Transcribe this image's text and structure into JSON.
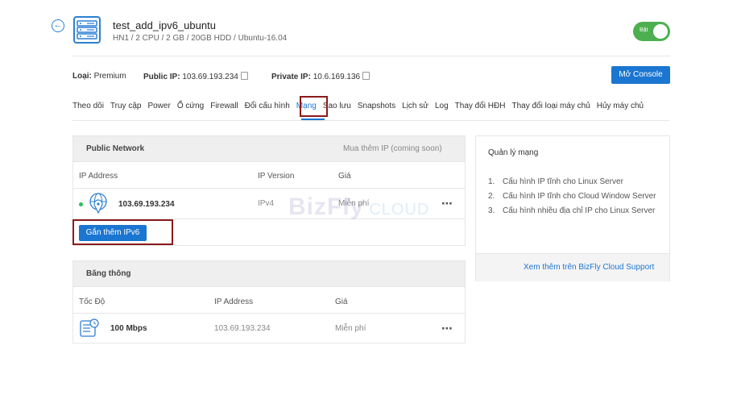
{
  "header": {
    "title": "test_add_ipv6_ubuntu",
    "subtitle": "HN1 / 2 CPU / 2 GB / 20GB HDD / Ubuntu-16.04",
    "toggle_label": "Bật"
  },
  "info": {
    "type_label": "Loại:",
    "type_value": "Premium",
    "public_ip_label": "Public IP:",
    "public_ip_value": "103.69.193.234",
    "private_ip_label": "Private IP:",
    "private_ip_value": "10.6.169.136",
    "console_button": "Mở Console"
  },
  "tabs": [
    "Theo dõi",
    "Truy cập",
    "Power",
    "Ổ cứng",
    "Firewall",
    "Đổi cấu hình",
    "Mạng",
    "Sao lưu",
    "Snapshots",
    "Lịch sử",
    "Log",
    "Thay đổi HĐH",
    "Thay đổi loại máy chủ",
    "Hủy máy chủ"
  ],
  "active_tab": "Mạng",
  "public_network": {
    "title": "Public Network",
    "buy_ip": "Mua thêm IP (coming soon)",
    "columns": [
      "IP Address",
      "IP Version",
      "Giá"
    ],
    "row": {
      "ip": "103.69.193.234",
      "version": "IPv4",
      "price": "Miễn phí",
      "status": "active"
    },
    "attach_ipv6_button": "Gắn thêm IPv6"
  },
  "bandwidth": {
    "title": "Băng thông",
    "columns": [
      "Tốc Độ",
      "IP Address",
      "Giá"
    ],
    "row": {
      "speed": "100 Mbps",
      "ip": "103.69.193.234",
      "price": "Miễn phí"
    }
  },
  "side_panel": {
    "title": "Quản lý mạng",
    "items": [
      "Cấu hình IP tĩnh cho Linux Server",
      "Cấu hình IP tĩnh cho Cloud Window Server",
      "Cấu hình nhiều địa chỉ IP cho Linux Server"
    ],
    "support_link": "Xem thêm trên BizFly Cloud Support"
  },
  "watermark": {
    "brand": "BizFly",
    "suffix": "CLOUD"
  },
  "colors": {
    "accent": "#1b76d1",
    "toggle_on": "#4caf50",
    "status_active": "#2cbf5a",
    "highlight_box": "#8b1a1a"
  }
}
